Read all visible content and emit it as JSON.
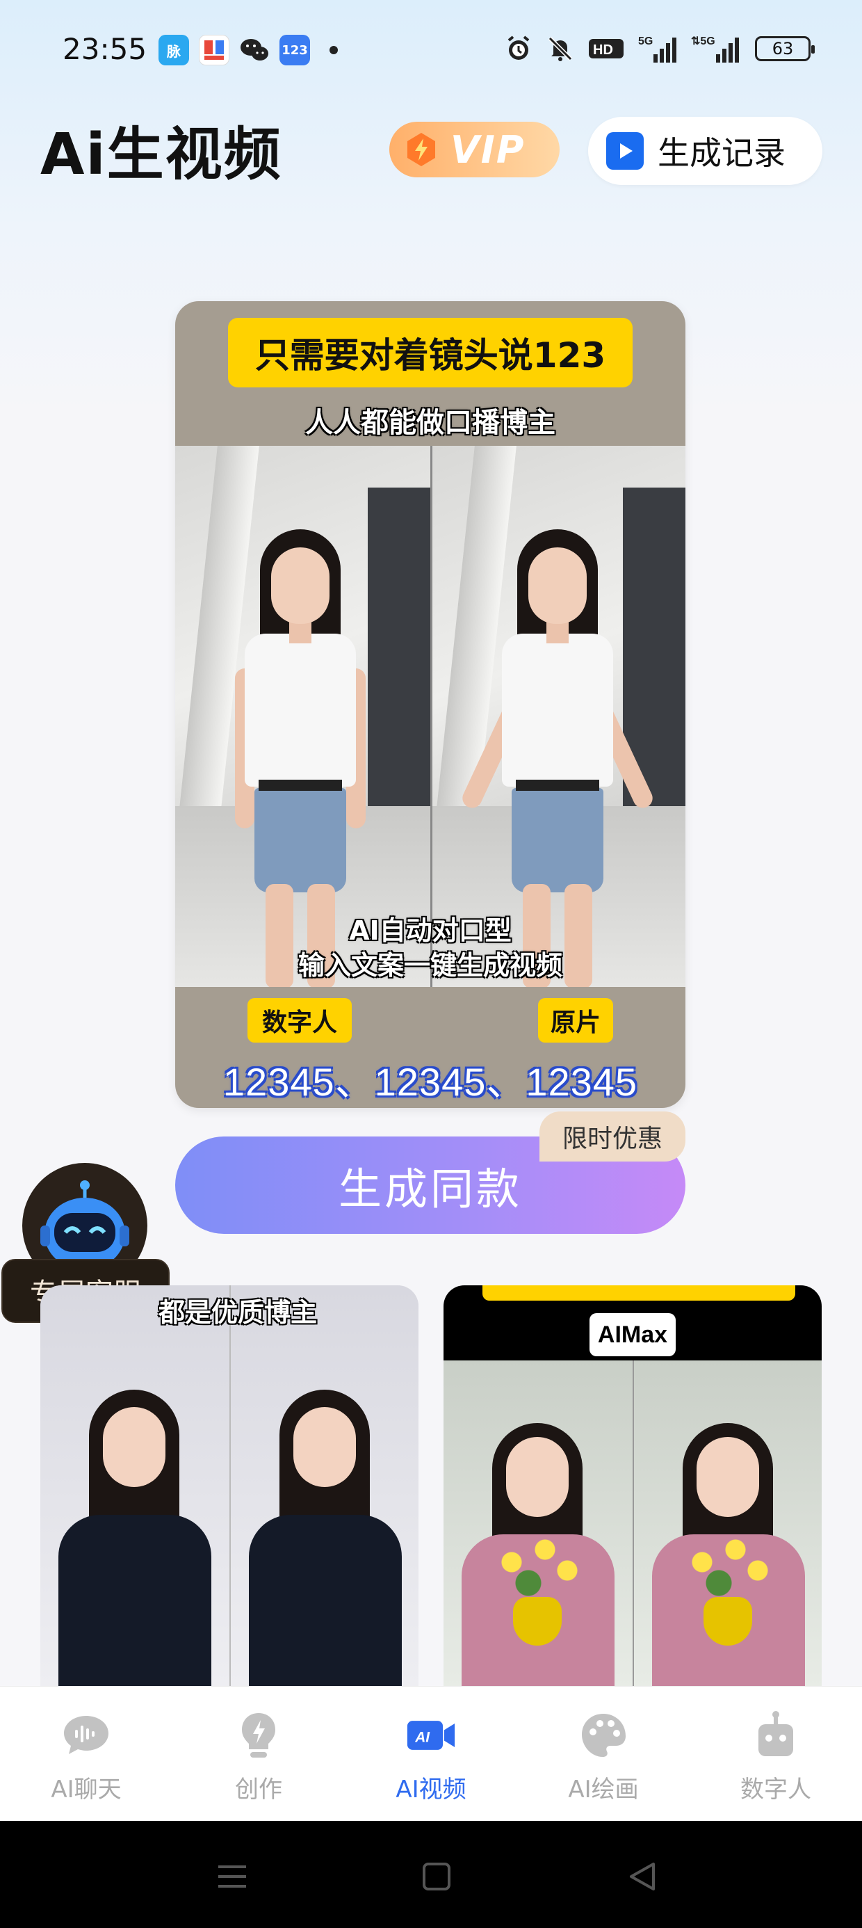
{
  "status_bar": {
    "time": "23:55",
    "notif_apps": [
      {
        "icon": "maimai-icon",
        "text": "脉",
        "color": "#2aa8f0"
      },
      {
        "icon": "news-app-icon",
        "text": "",
        "color": "#e8473a"
      },
      {
        "icon": "wechat-icon",
        "text": "",
        "color": "#222222"
      },
      {
        "icon": "keyboard-123-icon",
        "text": "123",
        "color": "#3a7cf2"
      }
    ],
    "network_1": "5G",
    "network_2": "5G",
    "hd_label": "HD",
    "battery": "63"
  },
  "header": {
    "title": "Ai生视频",
    "vip_label": "VIP",
    "history_button": "生成记录"
  },
  "hero": {
    "banner": "只需要对着镜头说123",
    "subtitle": "人人都能做口播博主",
    "caption_line1": "AI自动对口型",
    "caption_line2": "输入文案一键生成视频",
    "tag_left": "数字人",
    "tag_right": "原片",
    "numbers": "12345、12345、12345"
  },
  "actions": {
    "generate_button": "生成同款",
    "promo_badge": "限时优惠"
  },
  "support": {
    "label": "专属客服"
  },
  "cards": [
    {
      "caption": "都是优质博主"
    },
    {
      "tag": "AIMax"
    }
  ],
  "tabs": [
    {
      "label": "AI聊天",
      "icon": "chat-icon",
      "active": false
    },
    {
      "label": "创作",
      "icon": "bulb-icon",
      "active": false
    },
    {
      "label": "AI视频",
      "icon": "ai-video-icon",
      "active": true
    },
    {
      "label": "AI绘画",
      "icon": "palette-icon",
      "active": false
    },
    {
      "label": "数字人",
      "icon": "robot-icon",
      "active": false
    }
  ],
  "colors": {
    "accent": "#2f6bef",
    "generate_gradient_start": "#7f8ef7",
    "generate_gradient_end": "#c58af7",
    "banner_yellow": "#ffd200"
  }
}
